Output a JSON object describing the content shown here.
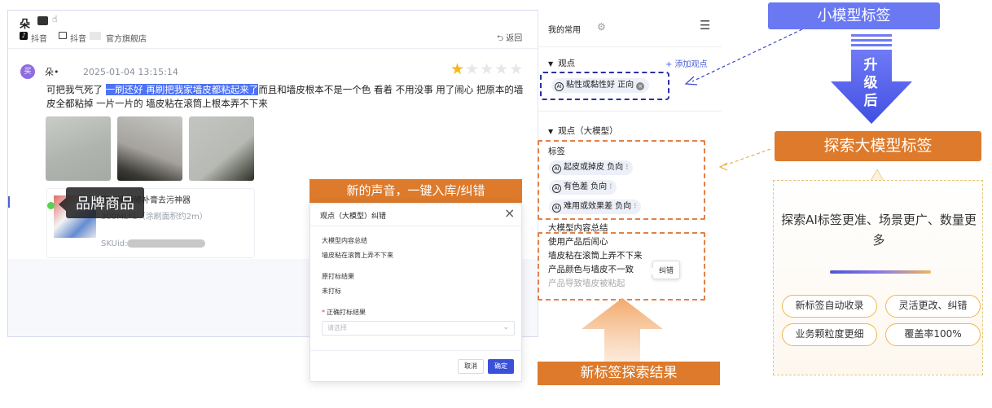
{
  "app": {
    "shop_name": "朵",
    "platform_label": "抖音",
    "shop_prefix": "抖音",
    "shop_suffix": "官方旗舰店",
    "back_label": "返回"
  },
  "review": {
    "avatar_text": "买",
    "user": "朵•",
    "timestamp": "2025-01-04 13:15:14",
    "rating": 1,
    "max_rating": 5,
    "text_before": "可把我气死了 ",
    "text_highlight": "一刷还好 再刷把我家墙皮都粘起来了",
    "text_after": "而且和墙皮根本不是一个色 看着 不用没事 用了闹心 把原本的墙皮全都粘掉 一片一片的 墙皮粘在滚筒上根本弄不下来"
  },
  "product": {
    "title": "家用墙面修补膏去污神器",
    "spec": "300ML*1（涂刷面积约2m）",
    "sku_label": "SKUid:"
  },
  "brand_tip": "品牌商品",
  "right_panel": {
    "title": "我的常用",
    "section_views": "观点",
    "add_view": "+ 添加观点",
    "view_chip": "粘性或黏性好 正向",
    "section_llm": "观点（大模型）",
    "tags_label": "标签",
    "llm_tags": [
      "起皮或掉皮 负向",
      "有色差 负向",
      "难用或效果差 负向"
    ],
    "summary_label": "大模型内容总结",
    "summary_lines": [
      "使用产品后闹心",
      "墙皮粘在滚筒上弄不下来",
      "产品颜色与墙皮不一致",
      "产品导致墙皮被粘起"
    ],
    "fix_label": "纠错"
  },
  "modal": {
    "title": "观点（大模型）纠错",
    "summary_label": "大模型内容总结",
    "summary_value": "墙皮粘在滚筒上弄不下来",
    "orig_label": "原打标结果",
    "orig_value": "未打标",
    "correct_label": "正确打标结果",
    "select_placeholder": "请选择",
    "cancel": "取消",
    "confirm": "确定"
  },
  "callouts": {
    "new_voice": "新的声音，一键入库/纠错",
    "new_tag_result": "新标签探索结果",
    "small_model_tag": "小模型标签",
    "upgrade": "升级后",
    "explore_llm_tag": "探索大模型标签",
    "info_text": "探索AI标签更准、场景更广、数量更多",
    "pills": [
      "新标签自动收录",
      "灵活更改、纠错",
      "业务颗粒度更细",
      "覆盖率100%"
    ]
  },
  "colors": {
    "accent_blue": "#4e72f6",
    "orange": "#dd7a2b",
    "purple": "#6a78f2",
    "star": "#f5b81b"
  }
}
